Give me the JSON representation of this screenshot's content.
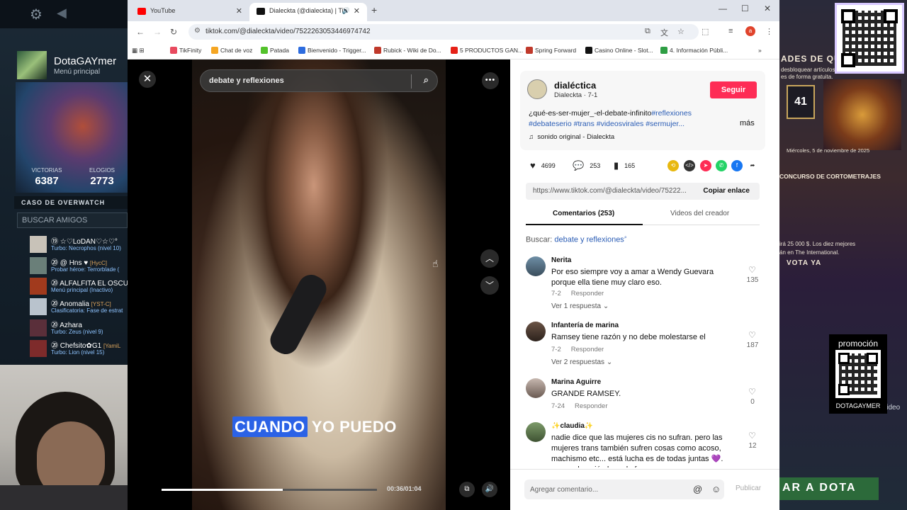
{
  "left_panel": {
    "profile": {
      "name": "DotaGAYmer",
      "sub": "Menú principal"
    },
    "stats": [
      {
        "label": "VICTORIAS",
        "value": "6387"
      },
      {
        "label": "ELOGIOS",
        "value": "2773"
      }
    ],
    "overwatch": "CASO DE OVERWATCH",
    "search_friends": "BUSCAR AMIGOS",
    "friends": [
      {
        "name": "⑲ ☆♡LoDAN♡☆♡°",
        "tag": "",
        "status": "Turbo: Necrophos (nivel 10)"
      },
      {
        "name": "⑳ @ Hns ♥",
        "tag": "[HycC]",
        "status": "Probar héroe: Terrorblade ("
      },
      {
        "name": "⑳ ALFALFITA EL OSCU",
        "tag": "",
        "status": "Menú principal (Inactivo)"
      },
      {
        "name": "⑳ Anomalia",
        "tag": "[YST-C]",
        "status": "Clasificatoria: Fase de estrat"
      },
      {
        "name": "⑳ Azhara",
        "tag": "",
        "status": "Turbo: Zeus (nivel 9)"
      },
      {
        "name": "⑳ Chefsito✿G1",
        "tag": "[YamiL",
        "status": "Turbo: Lion (nivel 15)"
      }
    ]
  },
  "right_panel": {
    "top_text": "ADES DE QUA",
    "top_sub": "desbloquear artículos c",
    "top_sub2": "es de forma gratuita.",
    "level": "41",
    "date": "Miércoles, 5 de noviembre de 2025",
    "contest": "CONCURSO DE CORTOMETRAJES",
    "prize1": "irá 25 000 $. Los diez mejores",
    "prize2": "án en The International.",
    "vote": "VOTA YA",
    "promo_title": "promoción",
    "promo_name": "DOTAGAYMER",
    "promo_side": "clideo",
    "banner": "AR A DOTA"
  },
  "browser": {
    "tabs": [
      {
        "title": "YouTube",
        "color": "#ff0000"
      },
      {
        "title": "Dialeckta (@dialeckta) | Tik",
        "color": "#111111"
      }
    ],
    "url": "tiktok.com/@dialeckta/video/7522263053446974742",
    "profile_initial": "a",
    "bookmarks": [
      {
        "label": "TikFinity",
        "color": "#e84a5f"
      },
      {
        "label": "Chat de voz",
        "color": "#f5a623"
      },
      {
        "label": "Patada",
        "color": "#53c22b"
      },
      {
        "label": "Bienvenido - Trigger...",
        "color": "#2d6cdf"
      },
      {
        "label": "Rubick - Wiki de Do...",
        "color": "#c0392b"
      },
      {
        "label": "5 PRODUCTOS GAN...",
        "color": "#e62117"
      },
      {
        "label": "Spring Forward",
        "color": "#c0392b"
      },
      {
        "label": "Casino Online - Slot...",
        "color": "#111111"
      },
      {
        "label": "4. Información Públi...",
        "color": "#2e9e44"
      }
    ]
  },
  "video": {
    "search": "debate y reflexiones",
    "caption_hl": "CUANDO",
    "caption_rest": "YO PUEDO",
    "time": "00:36/01:04",
    "progress": 0.5625
  },
  "post": {
    "username": "dialéctica",
    "nick": "Dialeckta · 7-1",
    "follow": "Seguir",
    "desc_plain": "¿qué-es-ser-mujer_-el-debate-infinito",
    "desc_tags": [
      "#reflexiones",
      "#debateserio",
      "#trans",
      "#videosvirales",
      "#sermujer..."
    ],
    "more": "más",
    "sound": "sonido original - Dialeckta",
    "likes": "4699",
    "comments": "253",
    "saves": "165",
    "link": "https://www.tiktok.com/@dialeckta/video/75222...",
    "copy": "Copiar enlace",
    "tab_comments": "Comentarios (253)",
    "tab_videos": "Videos del creador",
    "buscar_label": "Buscar:",
    "buscar_term": "debate y reflexiones",
    "comments_list": [
      {
        "user": "Nerita",
        "text": "Por eso siempre voy a amar a Wendy Guevara porque ella tiene muy claro eso.",
        "date": "7-2",
        "reply": "Responder",
        "replies": "Ver 1 respuesta",
        "likes": "135"
      },
      {
        "user": "Infantería de marina",
        "text": "Ramsey tiene razón y no debe molestarse el",
        "date": "7-2",
        "reply": "Responder",
        "replies": "Ver 2 respuestas",
        "likes": "187"
      },
      {
        "user": "Marina Aguirre",
        "text": "GRANDE RAMSEY.",
        "date": "7-24",
        "reply": "Responder",
        "replies": "",
        "likes": "0"
      },
      {
        "user": "✨claudia✨",
        "text": "nadie dice que las mujeres cis no sufran. pero las mujeres trans también sufren cosas como acoso, machismo etc... está lucha es de todas juntas 💜. porque la unión hace la fuerza",
        "date": "",
        "reply": "",
        "replies": "",
        "likes": "12"
      }
    ],
    "composer": "Agregar comentario...",
    "publish": "Publicar"
  }
}
